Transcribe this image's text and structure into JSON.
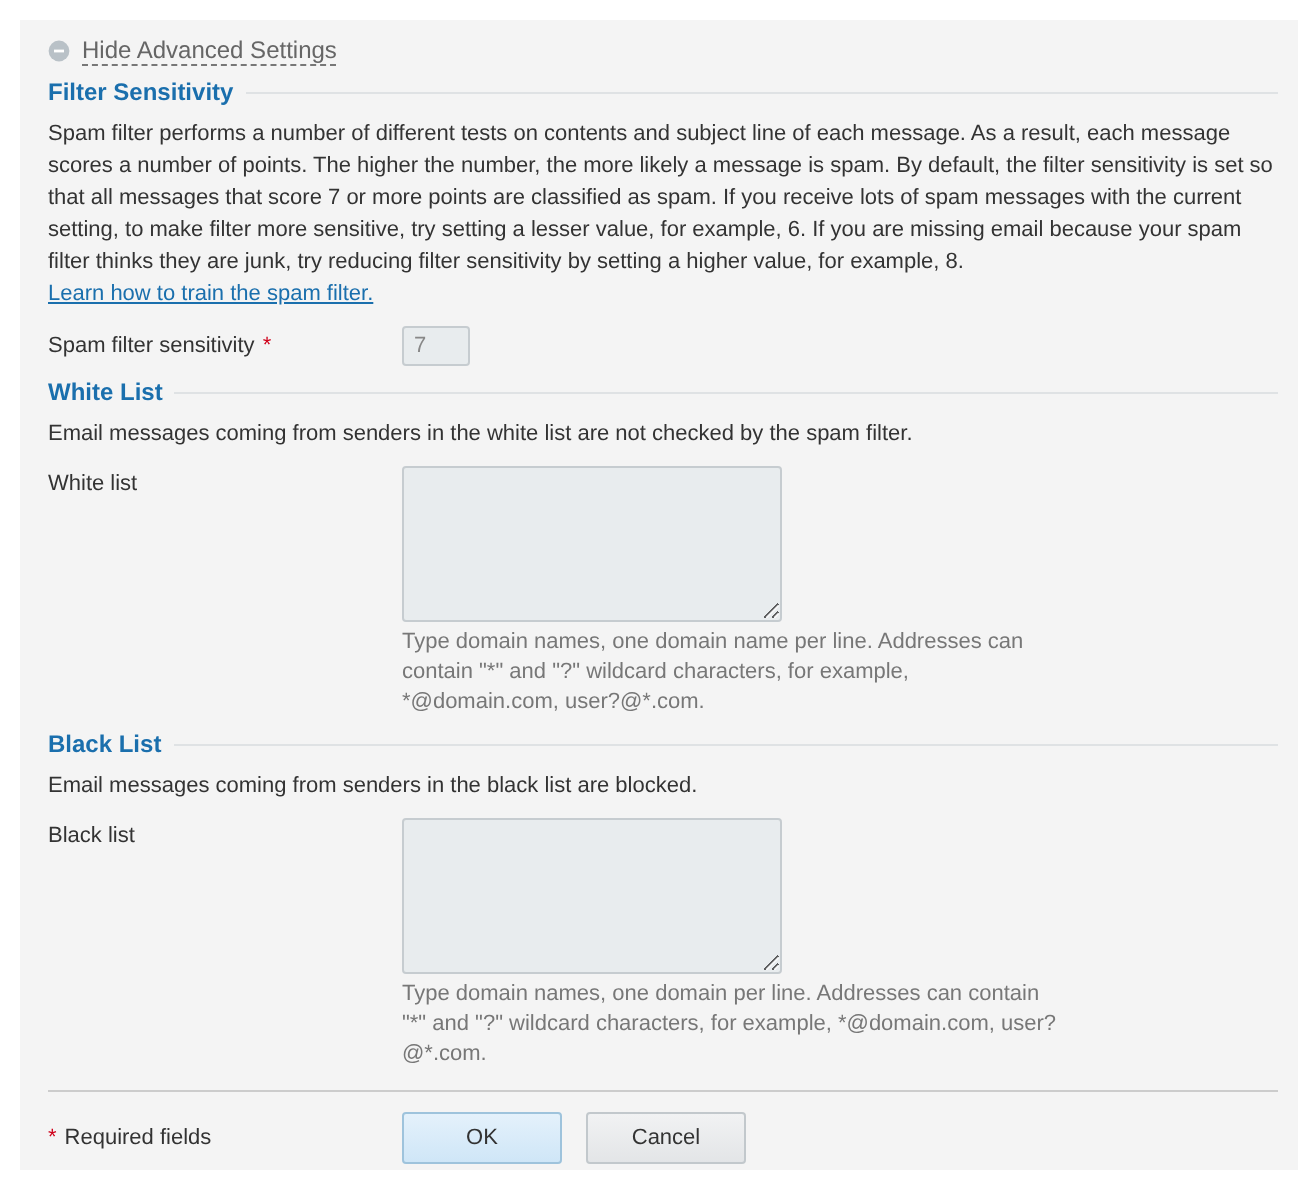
{
  "toggle": {
    "label": "Hide Advanced Settings",
    "expanded": true
  },
  "sections": [
    {
      "title": "Filter Sensitivity",
      "description": "Spam filter performs a number of different tests on contents and subject line of each message. As a result, each message scores a number of points. The higher the number, the more likely a message is spam. By default, the filter sensitivity is set so that all messages that score 7 or more points are classified as spam. If you receive lots of spam messages with the current setting, to make filter more sensitive, try setting a lesser value, for example, 6. If you are missing email because your spam filter thinks they are junk, try reducing filter sensitivity by setting a higher value, for example, 8.",
      "link": "Learn how to train the spam filter.",
      "fields": [
        {
          "kind": "input",
          "label": "Spam filter sensitivity",
          "required_mark": "*",
          "value": "7"
        }
      ]
    },
    {
      "title": "White List",
      "description": "Email messages coming from senders in the white list are not checked by the spam filter.",
      "fields": [
        {
          "kind": "textarea",
          "label": "White list",
          "hint": "Type domain names, one domain name per line. Addresses can contain \"*\" and \"?\" wildcard characters, for example, *@domain.com, user?@*.com."
        }
      ]
    },
    {
      "title": "Black List",
      "description": "Email messages coming from senders in the black list are blocked.",
      "fields": [
        {
          "kind": "textarea",
          "label": "Black list",
          "hint": "Type domain names, one domain per line. Addresses can contain \"*\" and \"?\" wildcard characters, for example, *@domain.com, user?@*.com."
        }
      ]
    }
  ],
  "footer": {
    "required_mark": "*",
    "required_note": "Required fields",
    "buttons": [
      {
        "label": "OK",
        "primary": true
      },
      {
        "label": "Cancel",
        "primary": false
      }
    ]
  }
}
